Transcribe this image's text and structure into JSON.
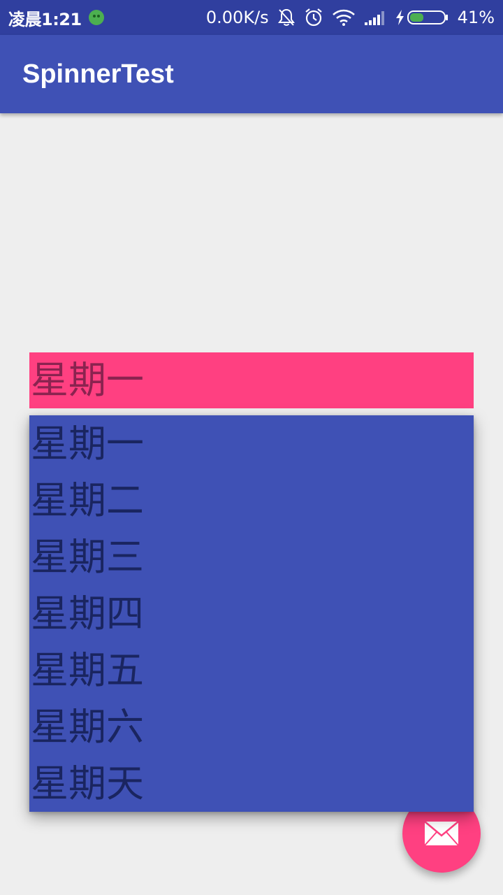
{
  "status_bar": {
    "time": "凌晨1:21",
    "net_speed": "0.00K/s",
    "battery_percent": "41%",
    "battery_level": 0.41,
    "icons": [
      "notify-app-icon",
      "mute-bell-icon",
      "alarm-icon",
      "wifi-icon",
      "signal-icon",
      "charging-icon",
      "battery-icon"
    ]
  },
  "app_bar": {
    "title": "SpinnerTest"
  },
  "spinner": {
    "selected": "星期一",
    "options": [
      "星期一",
      "星期二",
      "星期三",
      "星期四",
      "星期五",
      "星期六",
      "星期天"
    ]
  },
  "fab": {
    "icon": "mail-icon"
  },
  "colors": {
    "primary": "#3f51b5",
    "primary_dark": "#303f9f",
    "accent": "#ff4081",
    "background": "#eeeeee"
  }
}
